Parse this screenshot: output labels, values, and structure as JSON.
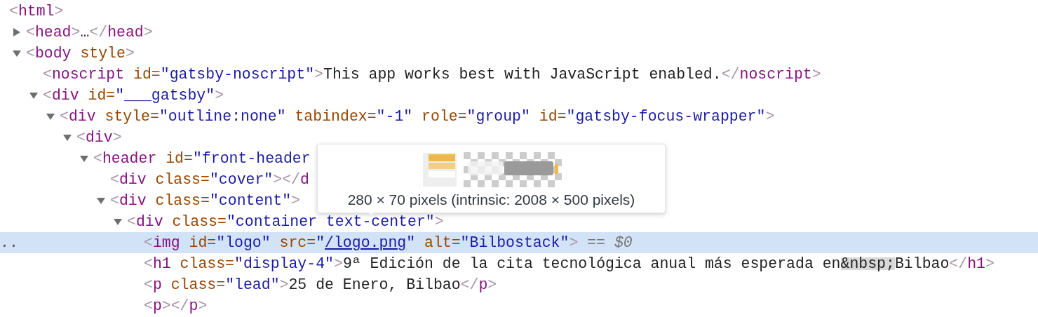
{
  "dom_tree": [
    {
      "tokens": [
        {
          "kind": "punct",
          "text": "<"
        },
        {
          "kind": "tag",
          "text": "html"
        },
        {
          "kind": "punct",
          "text": ">"
        }
      ],
      "selected": false,
      "children": [
        {
          "expanded": false,
          "selected": false,
          "tokens": [
            {
              "kind": "punct",
              "text": "<"
            },
            {
              "kind": "tag",
              "text": "head"
            },
            {
              "kind": "punct",
              "text": ">"
            },
            {
              "kind": "text",
              "text": "…"
            },
            {
              "kind": "punct",
              "text": "</"
            },
            {
              "kind": "tag",
              "text": "head"
            },
            {
              "kind": "punct",
              "text": ">"
            }
          ]
        },
        {
          "expanded": true,
          "selected": false,
          "tokens": [
            {
              "kind": "punct",
              "text": "<"
            },
            {
              "kind": "tag",
              "text": "body"
            },
            {
              "kind": "attr",
              "text": "style"
            },
            {
              "kind": "punct",
              "text": ">"
            }
          ],
          "children": [
            {
              "selected": false,
              "tokens": [
                {
                  "kind": "punct",
                  "text": "<"
                },
                {
                  "kind": "tag",
                  "text": "noscript"
                },
                {
                  "kind": "attr",
                  "text": "id="
                },
                {
                  "kind": "value",
                  "text": "\"gatsby-noscript\""
                },
                {
                  "kind": "punct",
                  "text": ">"
                },
                {
                  "kind": "text",
                  "text": "This app works best with JavaScript enabled."
                },
                {
                  "kind": "punct",
                  "text": "</"
                },
                {
                  "kind": "tag",
                  "text": "noscript"
                },
                {
                  "kind": "punct",
                  "text": ">"
                }
              ]
            },
            {
              "expanded": true,
              "selected": false,
              "tokens": [
                {
                  "kind": "punct",
                  "text": "<"
                },
                {
                  "kind": "tag",
                  "text": "div"
                },
                {
                  "kind": "attr",
                  "text": "id="
                },
                {
                  "kind": "value",
                  "text": "\"___gatsby\""
                },
                {
                  "kind": "punct",
                  "text": ">"
                }
              ],
              "children": [
                {
                  "expanded": true,
                  "selected": false,
                  "tokens": [
                    {
                      "kind": "punct",
                      "text": "<"
                    },
                    {
                      "kind": "tag",
                      "text": "div"
                    },
                    {
                      "kind": "attr",
                      "text": "style="
                    },
                    {
                      "kind": "value",
                      "text": "\"outline:none\""
                    },
                    {
                      "kind": "attr",
                      "text": "tabindex="
                    },
                    {
                      "kind": "value",
                      "text": "\"-1\""
                    },
                    {
                      "kind": "attr",
                      "text": "role="
                    },
                    {
                      "kind": "value",
                      "text": "\"group\""
                    },
                    {
                      "kind": "attr",
                      "text": "id="
                    },
                    {
                      "kind": "value",
                      "text": "\"gatsby-focus-wrapper\""
                    },
                    {
                      "kind": "punct",
                      "text": ">"
                    }
                  ],
                  "children": [
                    {
                      "expanded": true,
                      "selected": false,
                      "tokens": [
                        {
                          "kind": "punct",
                          "text": "<"
                        },
                        {
                          "kind": "tag",
                          "text": "div"
                        },
                        {
                          "kind": "punct",
                          "text": ">"
                        }
                      ],
                      "children": [
                        {
                          "expanded": true,
                          "selected": false,
                          "tokens": [
                            {
                              "kind": "punct",
                              "text": "<"
                            },
                            {
                              "kind": "tag",
                              "text": "header"
                            },
                            {
                              "kind": "attr",
                              "text": "id="
                            },
                            {
                              "kind": "value",
                              "text": "\"front-header"
                            }
                          ],
                          "children": [
                            {
                              "selected": false,
                              "tokens": [
                                {
                                  "kind": "punct",
                                  "text": "<"
                                },
                                {
                                  "kind": "tag",
                                  "text": "div"
                                },
                                {
                                  "kind": "attr",
                                  "text": "class="
                                },
                                {
                                  "kind": "value",
                                  "text": "\"cover\""
                                },
                                {
                                  "kind": "punct",
                                  "text": ">"
                                },
                                {
                                  "kind": "punct",
                                  "text": "</"
                                },
                                {
                                  "kind": "tag",
                                  "text": "d"
                                }
                              ]
                            },
                            {
                              "expanded": true,
                              "selected": false,
                              "tokens": [
                                {
                                  "kind": "punct",
                                  "text": "<"
                                },
                                {
                                  "kind": "tag",
                                  "text": "div"
                                },
                                {
                                  "kind": "attr",
                                  "text": "class="
                                },
                                {
                                  "kind": "value",
                                  "text": "\"content\""
                                },
                                {
                                  "kind": "punct",
                                  "text": ">"
                                }
                              ],
                              "children": [
                                {
                                  "expanded": true,
                                  "selected": false,
                                  "tokens": [
                                    {
                                      "kind": "punct",
                                      "text": "<"
                                    },
                                    {
                                      "kind": "tag",
                                      "text": "div"
                                    },
                                    {
                                      "kind": "attr",
                                      "text": "class="
                                    },
                                    {
                                      "kind": "value",
                                      "text": "\"container text-center\""
                                    },
                                    {
                                      "kind": "punct",
                                      "text": ">"
                                    }
                                  ],
                                  "children": [
                                    {
                                      "selected": true,
                                      "gutter_text": "..",
                                      "tokens": [
                                        {
                                          "kind": "punct",
                                          "text": "<"
                                        },
                                        {
                                          "kind": "tag",
                                          "text": "img"
                                        },
                                        {
                                          "kind": "attr",
                                          "text": "id="
                                        },
                                        {
                                          "kind": "value",
                                          "text": "\"logo\""
                                        },
                                        {
                                          "kind": "attr",
                                          "text": "src="
                                        },
                                        {
                                          "kind": "value",
                                          "text": "\""
                                        },
                                        {
                                          "kind": "link",
                                          "text": "/logo.png"
                                        },
                                        {
                                          "kind": "value",
                                          "text": "\""
                                        },
                                        {
                                          "kind": "attr",
                                          "text": "alt="
                                        },
                                        {
                                          "kind": "value",
                                          "text": "\"Bilbostack\""
                                        },
                                        {
                                          "kind": "punct",
                                          "text": ">"
                                        },
                                        {
                                          "kind": "marker",
                                          "text": "=="
                                        },
                                        {
                                          "kind": "console_ref",
                                          "text": "$0"
                                        }
                                      ]
                                    },
                                    {
                                      "selected": false,
                                      "tokens": [
                                        {
                                          "kind": "punct",
                                          "text": "<"
                                        },
                                        {
                                          "kind": "tag",
                                          "text": "h1"
                                        },
                                        {
                                          "kind": "attr",
                                          "text": "class="
                                        },
                                        {
                                          "kind": "value",
                                          "text": "\"display-4\""
                                        },
                                        {
                                          "kind": "punct",
                                          "text": ">"
                                        },
                                        {
                                          "kind": "text",
                                          "text": "9ª Edición de la cita tecnológica anual más esperada en"
                                        },
                                        {
                                          "kind": "entity",
                                          "text": "&nbsp;"
                                        },
                                        {
                                          "kind": "text",
                                          "text": "Bilbao"
                                        },
                                        {
                                          "kind": "punct",
                                          "text": "</"
                                        },
                                        {
                                          "kind": "tag",
                                          "text": "h1"
                                        },
                                        {
                                          "kind": "punct",
                                          "text": ">"
                                        }
                                      ]
                                    },
                                    {
                                      "selected": false,
                                      "tokens": [
                                        {
                                          "kind": "punct",
                                          "text": "<"
                                        },
                                        {
                                          "kind": "tag",
                                          "text": "p"
                                        },
                                        {
                                          "kind": "attr",
                                          "text": "class="
                                        },
                                        {
                                          "kind": "value",
                                          "text": "\"lead\""
                                        },
                                        {
                                          "kind": "punct",
                                          "text": ">"
                                        },
                                        {
                                          "kind": "text",
                                          "text": "25 de Enero, Bilbao"
                                        },
                                        {
                                          "kind": "punct",
                                          "text": "</"
                                        },
                                        {
                                          "kind": "tag",
                                          "text": "p"
                                        },
                                        {
                                          "kind": "punct",
                                          "text": ">"
                                        }
                                      ]
                                    },
                                    {
                                      "selected": false,
                                      "tokens": [
                                        {
                                          "kind": "punct",
                                          "text": "<"
                                        },
                                        {
                                          "kind": "tag",
                                          "text": "p"
                                        },
                                        {
                                          "kind": "punct",
                                          "text": ">"
                                        },
                                        {
                                          "kind": "punct",
                                          "text": "</"
                                        },
                                        {
                                          "kind": "tag",
                                          "text": "p"
                                        },
                                        {
                                          "kind": "punct",
                                          "text": ">"
                                        }
                                      ]
                                    }
                                  ]
                                }
                              ]
                            }
                          ]
                        }
                      ]
                    }
                  ]
                }
              ]
            }
          ]
        }
      ]
    }
  ],
  "tooltip": {
    "size_text": "280 × 70 pixels (intrinsic: 2008 × 500 pixels)"
  }
}
